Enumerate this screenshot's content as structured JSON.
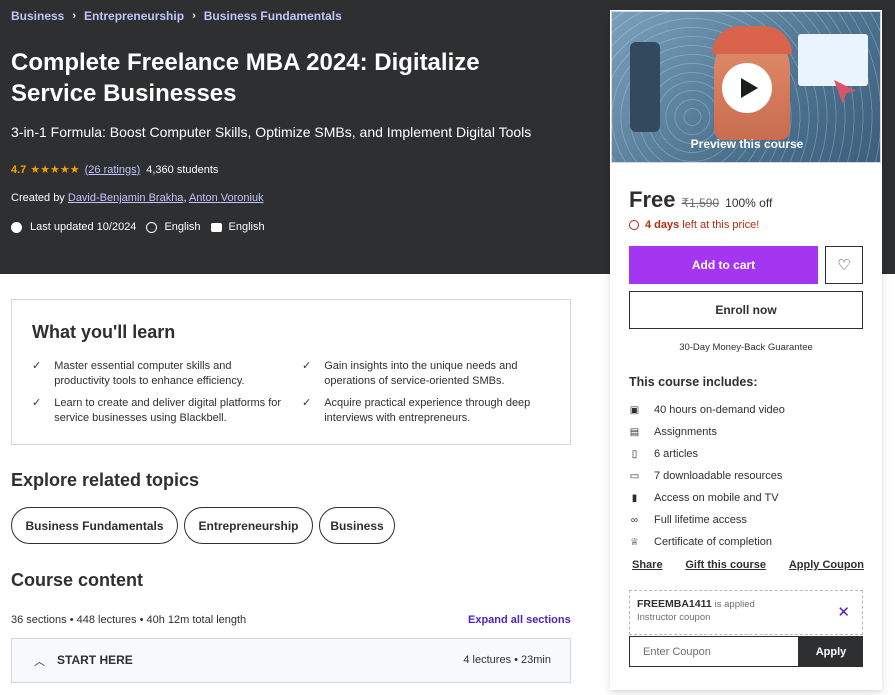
{
  "breadcrumb": [
    "Business",
    "Entrepreneurship",
    "Business Fundamentals"
  ],
  "course": {
    "title": "Complete Freelance MBA 2024: Digitalize Service Businesses",
    "subtitle": "3-in-1 Formula: Boost Computer Skills, Optimize SMBs, and Implement Digital Tools",
    "rating": "4.7",
    "rating_value": 4.7,
    "ratings_count": "(26 ratings)",
    "students": "4,360 students",
    "created_by_label": "Created by",
    "instructors": [
      "David-Benjamin Brakha",
      "Anton Voroniuk"
    ],
    "last_updated": "Last updated 10/2024",
    "language": "English",
    "captions": "English"
  },
  "sidebar": {
    "preview_label": "Preview this course",
    "price": "Free",
    "original_price": "₹1,590",
    "discount": "100% off",
    "timer_bold": "4 days",
    "timer_rest": "left at this price!",
    "add_to_cart": "Add to cart",
    "enroll": "Enroll now",
    "guarantee": "30-Day Money-Back Guarantee",
    "includes_title": "This course includes:",
    "includes": [
      {
        "icon": "video-icon",
        "label": "40 hours on-demand video"
      },
      {
        "icon": "assignment-icon",
        "label": "Assignments"
      },
      {
        "icon": "article-icon",
        "label": "6 articles"
      },
      {
        "icon": "download-icon",
        "label": "7 downloadable resources"
      },
      {
        "icon": "mobile-icon",
        "label": "Access on mobile and TV"
      },
      {
        "icon": "infinity-icon",
        "label": "Full lifetime access"
      },
      {
        "icon": "trophy-icon",
        "label": "Certificate of completion"
      }
    ],
    "links": {
      "share": "Share",
      "gift": "Gift this course",
      "coupon": "Apply Coupon"
    },
    "coupon_code": "FREEMBA1411",
    "coupon_applied": "is applied",
    "coupon_type": "Instructor coupon",
    "coupon_placeholder": "Enter Coupon",
    "apply": "Apply"
  },
  "learn": {
    "title": "What you'll learn",
    "items": [
      "Master essential computer skills and productivity tools to enhance efficiency.",
      "Gain insights into the unique needs and operations of service-oriented SMBs.",
      "Learn to create and deliver digital platforms for service businesses using Blackbell.",
      "Acquire practical experience through deep interviews with entrepreneurs."
    ]
  },
  "related": {
    "title": "Explore related topics",
    "topics": [
      "Business Fundamentals",
      "Entrepreneurship",
      "Business"
    ]
  },
  "content": {
    "title": "Course content",
    "meta": "36 sections • 448 lectures • 40h 12m total length",
    "expand": "Expand all sections",
    "section_name": "START HERE",
    "section_meta": "4 lectures • 23min"
  },
  "colors": {
    "accent": "#a435f0",
    "link": "#5022c3",
    "hero": "#2d2f31",
    "star": "#f69c08",
    "alert": "#b32d0f"
  }
}
